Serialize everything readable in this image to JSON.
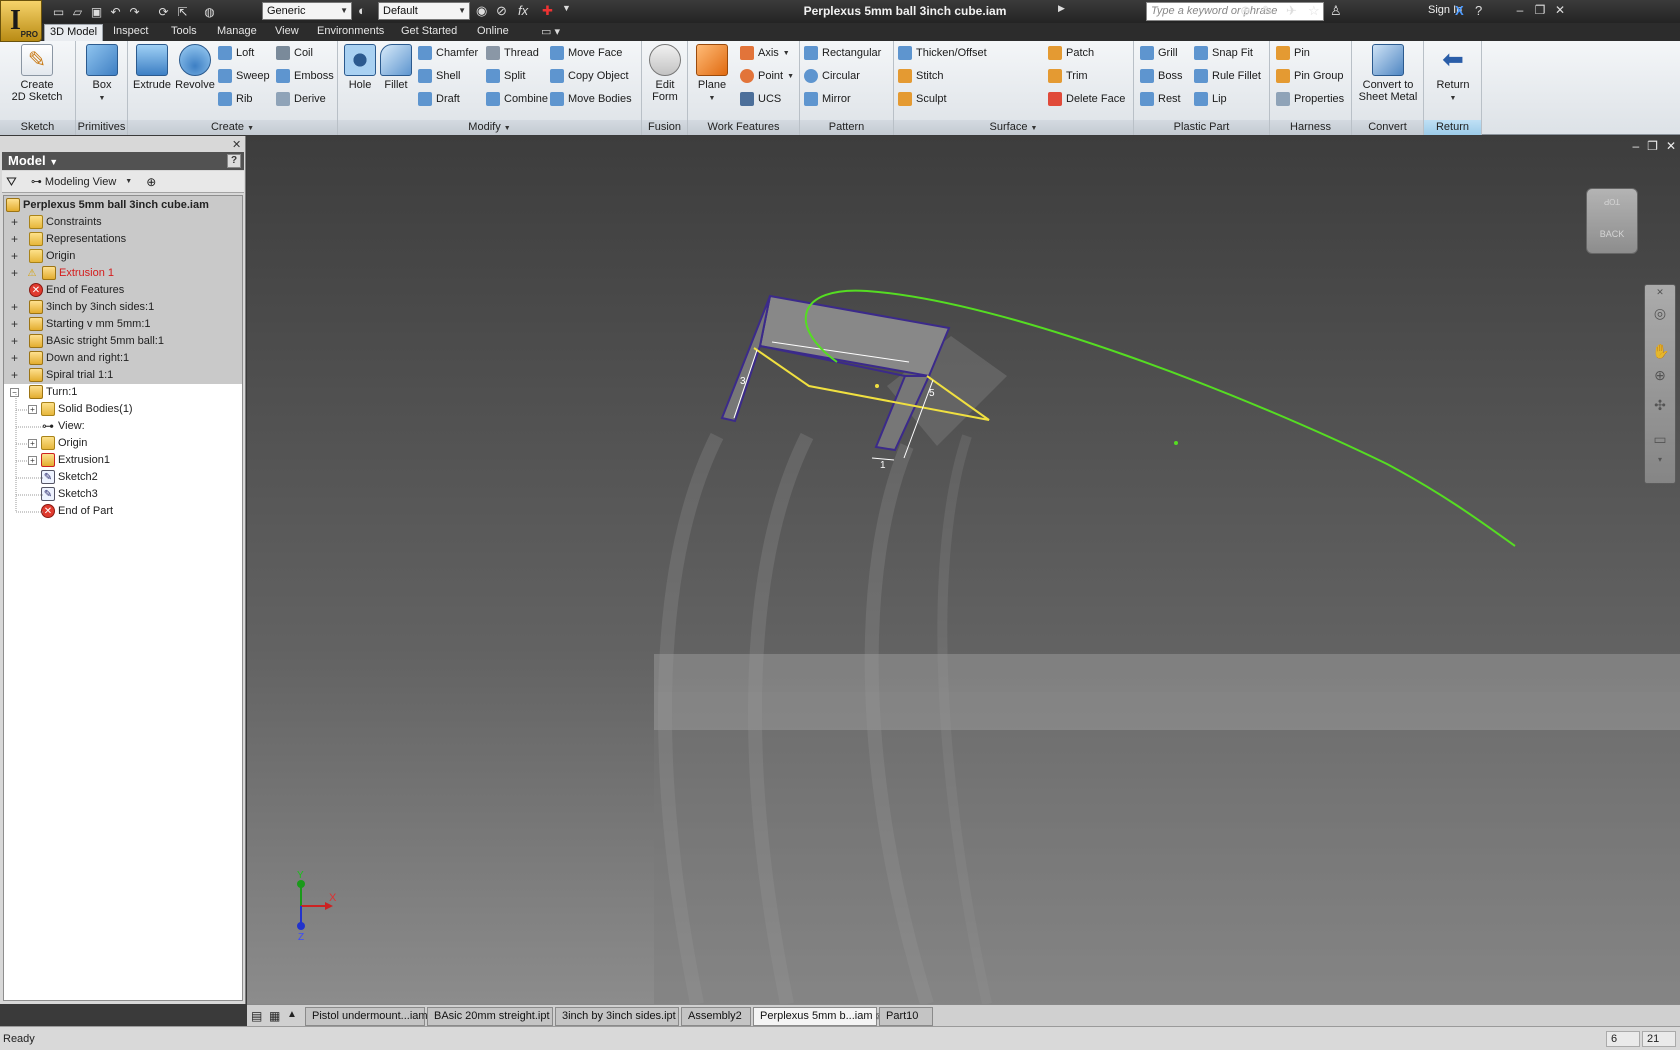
{
  "window": {
    "title": "Perplexus 5mm ball 3inch cube.iam",
    "app_badge": "PRO",
    "search_placeholder": "Type a keyword or phrase",
    "sign_in": "Sign In"
  },
  "qat": {
    "material": "Generic",
    "appearance": "Default"
  },
  "tabs": [
    "3D Model",
    "Inspect",
    "Tools",
    "Manage",
    "View",
    "Environments",
    "Get Started",
    "Online"
  ],
  "ribbon": {
    "sketch": {
      "label": "Sketch",
      "create": "Create\n2D Sketch"
    },
    "primitives": {
      "label": "Primitives",
      "box": "Box"
    },
    "create": {
      "label": "Create",
      "extrude": "Extrude",
      "revolve": "Revolve",
      "loft": "Loft",
      "sweep": "Sweep",
      "rib": "Rib",
      "coil": "Coil",
      "emboss": "Emboss",
      "derive": "Derive"
    },
    "modify": {
      "label": "Modify",
      "hole": "Hole",
      "fillet": "Fillet",
      "chamfer": "Chamfer",
      "shell": "Shell",
      "draft": "Draft",
      "thread": "Thread",
      "split": "Split",
      "combine": "Combine",
      "move_face": "Move Face",
      "copy_object": "Copy Object",
      "move_bodies": "Move Bodies"
    },
    "fusion": {
      "label": "Fusion",
      "edit_form": "Edit\nForm"
    },
    "work_features": {
      "label": "Work Features",
      "plane": "Plane",
      "axis": "Axis",
      "point": "Point",
      "ucs": "UCS"
    },
    "pattern": {
      "label": "Pattern",
      "rectangular": "Rectangular",
      "circular": "Circular",
      "mirror": "Mirror"
    },
    "surface": {
      "label": "Surface",
      "thicken": "Thicken/Offset",
      "stitch": "Stitch",
      "sculpt": "Sculpt",
      "patch": "Patch",
      "trim": "Trim",
      "delete_face": "Delete Face"
    },
    "plastic_part": {
      "label": "Plastic Part",
      "grill": "Grill",
      "boss": "Boss",
      "rest": "Rest",
      "snap_fit": "Snap Fit",
      "rule_fillet": "Rule Fillet",
      "lip": "Lip"
    },
    "harness": {
      "label": "Harness",
      "pin": "Pin",
      "pin_group": "Pin Group",
      "properties": "Properties"
    },
    "convert": {
      "label": "Convert",
      "sheet_metal": "Convert to\nSheet Metal"
    },
    "return": {
      "label": "Return",
      "return": "Return"
    }
  },
  "browser": {
    "title": "Model",
    "view": "Modeling View",
    "help": "?",
    "tree": [
      {
        "label": "Perplexus 5mm ball 3inch cube.iam",
        "icon": "assembly"
      },
      {
        "label": "Constraints",
        "icon": "folder"
      },
      {
        "label": "Representations",
        "icon": "representations"
      },
      {
        "label": "Origin",
        "icon": "folder"
      },
      {
        "label": "Extrusion 1",
        "icon": "warning-part"
      },
      {
        "label": "End of Features",
        "icon": "end"
      },
      {
        "label": "3inch by 3inch sides:1",
        "icon": "part"
      },
      {
        "label": "Starting v mm 5mm:1",
        "icon": "part"
      },
      {
        "label": "BAsic stright 5mm ball:1",
        "icon": "part"
      },
      {
        "label": "Down and right:1",
        "icon": "part"
      },
      {
        "label": "Spiral trial 1:1",
        "icon": "part"
      },
      {
        "label": "Turn:1",
        "icon": "part"
      },
      {
        "label": "Solid Bodies(1)",
        "icon": "folder"
      },
      {
        "label": "View:",
        "icon": "view"
      },
      {
        "label": "Origin",
        "icon": "folder"
      },
      {
        "label": "Extrusion1",
        "icon": "extrusion"
      },
      {
        "label": "Sketch2",
        "icon": "sketch"
      },
      {
        "label": "Sketch3",
        "icon": "sketch"
      },
      {
        "label": "End of Part",
        "icon": "end"
      }
    ]
  },
  "viewcube": {
    "top": "TOP",
    "back": "BACK"
  },
  "axes": {
    "x": "X",
    "y": "Y",
    "z": "Z"
  },
  "dimensions": {
    "d3": "3",
    "d5": "5",
    "d1": "1"
  },
  "doc_tabs": [
    "Pistol undermount...iam",
    "BAsic 20mm streight.ipt",
    "3inch by 3inch sides.ipt",
    "Assembly2",
    "Perplexus 5mm b...iam",
    "Part10"
  ],
  "status": {
    "text": "Ready",
    "count_a": "6",
    "count_b": "21"
  },
  "colors": {
    "accent": "#3a6fb0",
    "sketch_yellow": "#f0e040",
    "curve_green": "#55dd22",
    "edge_purple": "#3b2a8a",
    "warning_red": "#d41c1c"
  }
}
